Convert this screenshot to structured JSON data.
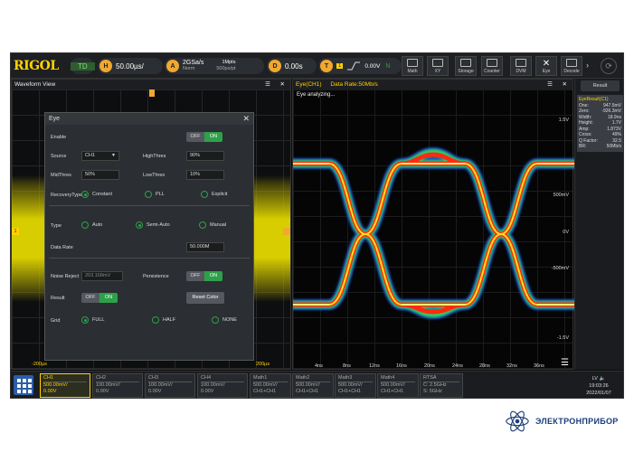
{
  "topbar": {
    "logo": "RIGOL",
    "mode": "TD",
    "h_label": "H",
    "timebase": "50.00µs/",
    "a_label": "A",
    "sample_rate": "2GSa/s",
    "acq_mode": "Norm",
    "mem_depth": "1Mpts",
    "mem_rate": "500ps/pt",
    "d_label": "D",
    "delay": "0.00s",
    "t_label": "T",
    "trig_source": "1",
    "trig_level": "0.00V",
    "trig_n": "N",
    "tools": [
      "Math",
      "XY",
      "Storage",
      "Counter",
      "DVM",
      "Eye",
      "Decode"
    ]
  },
  "waveform": {
    "title": "Waveform View",
    "marker_left": "1",
    "time_left": "-200µs",
    "time_right": "200µs"
  },
  "dialog": {
    "title": "Eye",
    "enable_label": "Enable",
    "off": "OFF",
    "on": "ON",
    "source_label": "Source",
    "source_value": "CH1",
    "highthres_label": "HighThres",
    "highthres_value": "90%",
    "midthres_label": "MidThres",
    "midthres_value": "50%",
    "lowthres_label": "LowThres",
    "lowthres_value": "10%",
    "recovery_label": "RecoveryType",
    "recovery_options": [
      "Constant",
      "PLL",
      "Explicit"
    ],
    "type_label": "Type",
    "type_options": [
      "Auto",
      "Semi-Auto",
      "Manual"
    ],
    "datarate_label": "Data Rate",
    "datarate_value": "50.000M",
    "noise_label": "Noise Reject",
    "noise_value": "203.168mV",
    "persistence_label": "Persistence",
    "result_label": "Result",
    "reset_color": "Reset Color",
    "grid_label": "Grid",
    "grid_options": [
      "FULL",
      "HALF",
      "NONE"
    ]
  },
  "eye": {
    "title": "Eye(CH1)",
    "datarate": "Data Rate:50Mb/s",
    "status": "Eye analyzing...",
    "y_labels": [
      "1.5V",
      "500mV",
      "0V",
      "-500mV",
      "-1.5V"
    ],
    "x_labels": [
      "4ns",
      "8ns",
      "12ns",
      "16ns",
      "20ns",
      "24ns",
      "28ns",
      "32ns",
      "36ns"
    ]
  },
  "result": {
    "header": "Result",
    "title": "EyeResult(C1)",
    "rows": [
      {
        "k": "One:",
        "v": "947.5mV"
      },
      {
        "k": "Zero:",
        "v": "-926.3mV"
      },
      {
        "k": "Width:",
        "v": "18.9ns"
      },
      {
        "k": "Height:",
        "v": "1.7V"
      },
      {
        "k": "Amp:",
        "v": "1.873V"
      },
      {
        "k": "Cross:",
        "v": "49%"
      },
      {
        "k": "Q Factor:",
        "v": "32.5"
      },
      {
        "k": "BR:",
        "v": "50Mb/s"
      }
    ]
  },
  "channels": [
    {
      "name": "CH1",
      "v1": "500.00mV/",
      "v2": "0.00V"
    },
    {
      "name": "CH2",
      "v1": "100.00mV/",
      "v2": "0.00V"
    },
    {
      "name": "CH3",
      "v1": "100.00mV/",
      "v2": "0.00V"
    },
    {
      "name": "CH4",
      "v1": "100.00mV/",
      "v2": "0.00V"
    },
    {
      "name": "Math1",
      "v1": "500.00mV/",
      "v2": "CH1+CH1"
    },
    {
      "name": "Math2",
      "v1": "500.00mV/",
      "v2": "CH1+CH1"
    },
    {
      "name": "Math3",
      "v1": "500.00mV/",
      "v2": "CH1+CH1"
    },
    {
      "name": "Math4",
      "v1": "500.00mV/",
      "v2": "CH1+CH1"
    },
    {
      "name": "RTSA",
      "v1": "C: 2.5GHz",
      "v2": "S: 5GHz"
    }
  ],
  "clock": {
    "lv": "LV",
    "time": "19:03:26",
    "date": "2022/01/07"
  },
  "brand": "ЭЛЕКТРОНПРИБОР",
  "colors": {
    "accent": "#ffd200",
    "on": "#2ea04a",
    "orange": "#f0a830"
  }
}
